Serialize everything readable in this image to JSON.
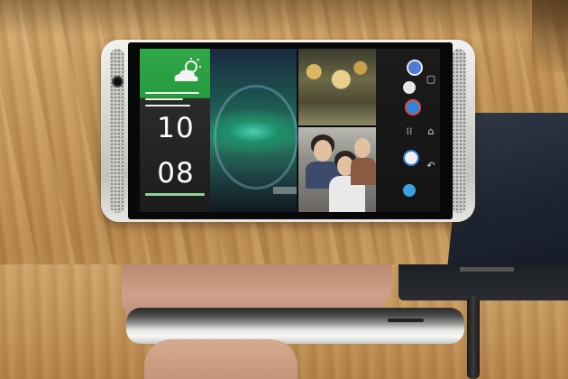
{
  "widget": {
    "time_hours": "10",
    "time_minutes": "08"
  },
  "icons": {
    "weather": "weather-cloud-sun-icon",
    "home": "home-icon",
    "back": "back-icon",
    "recent": "recent-apps-icon"
  },
  "colors": {
    "widget_green": "#2fa848",
    "phone_silver": "#d7d7d4",
    "table_wood": "#c39355"
  }
}
